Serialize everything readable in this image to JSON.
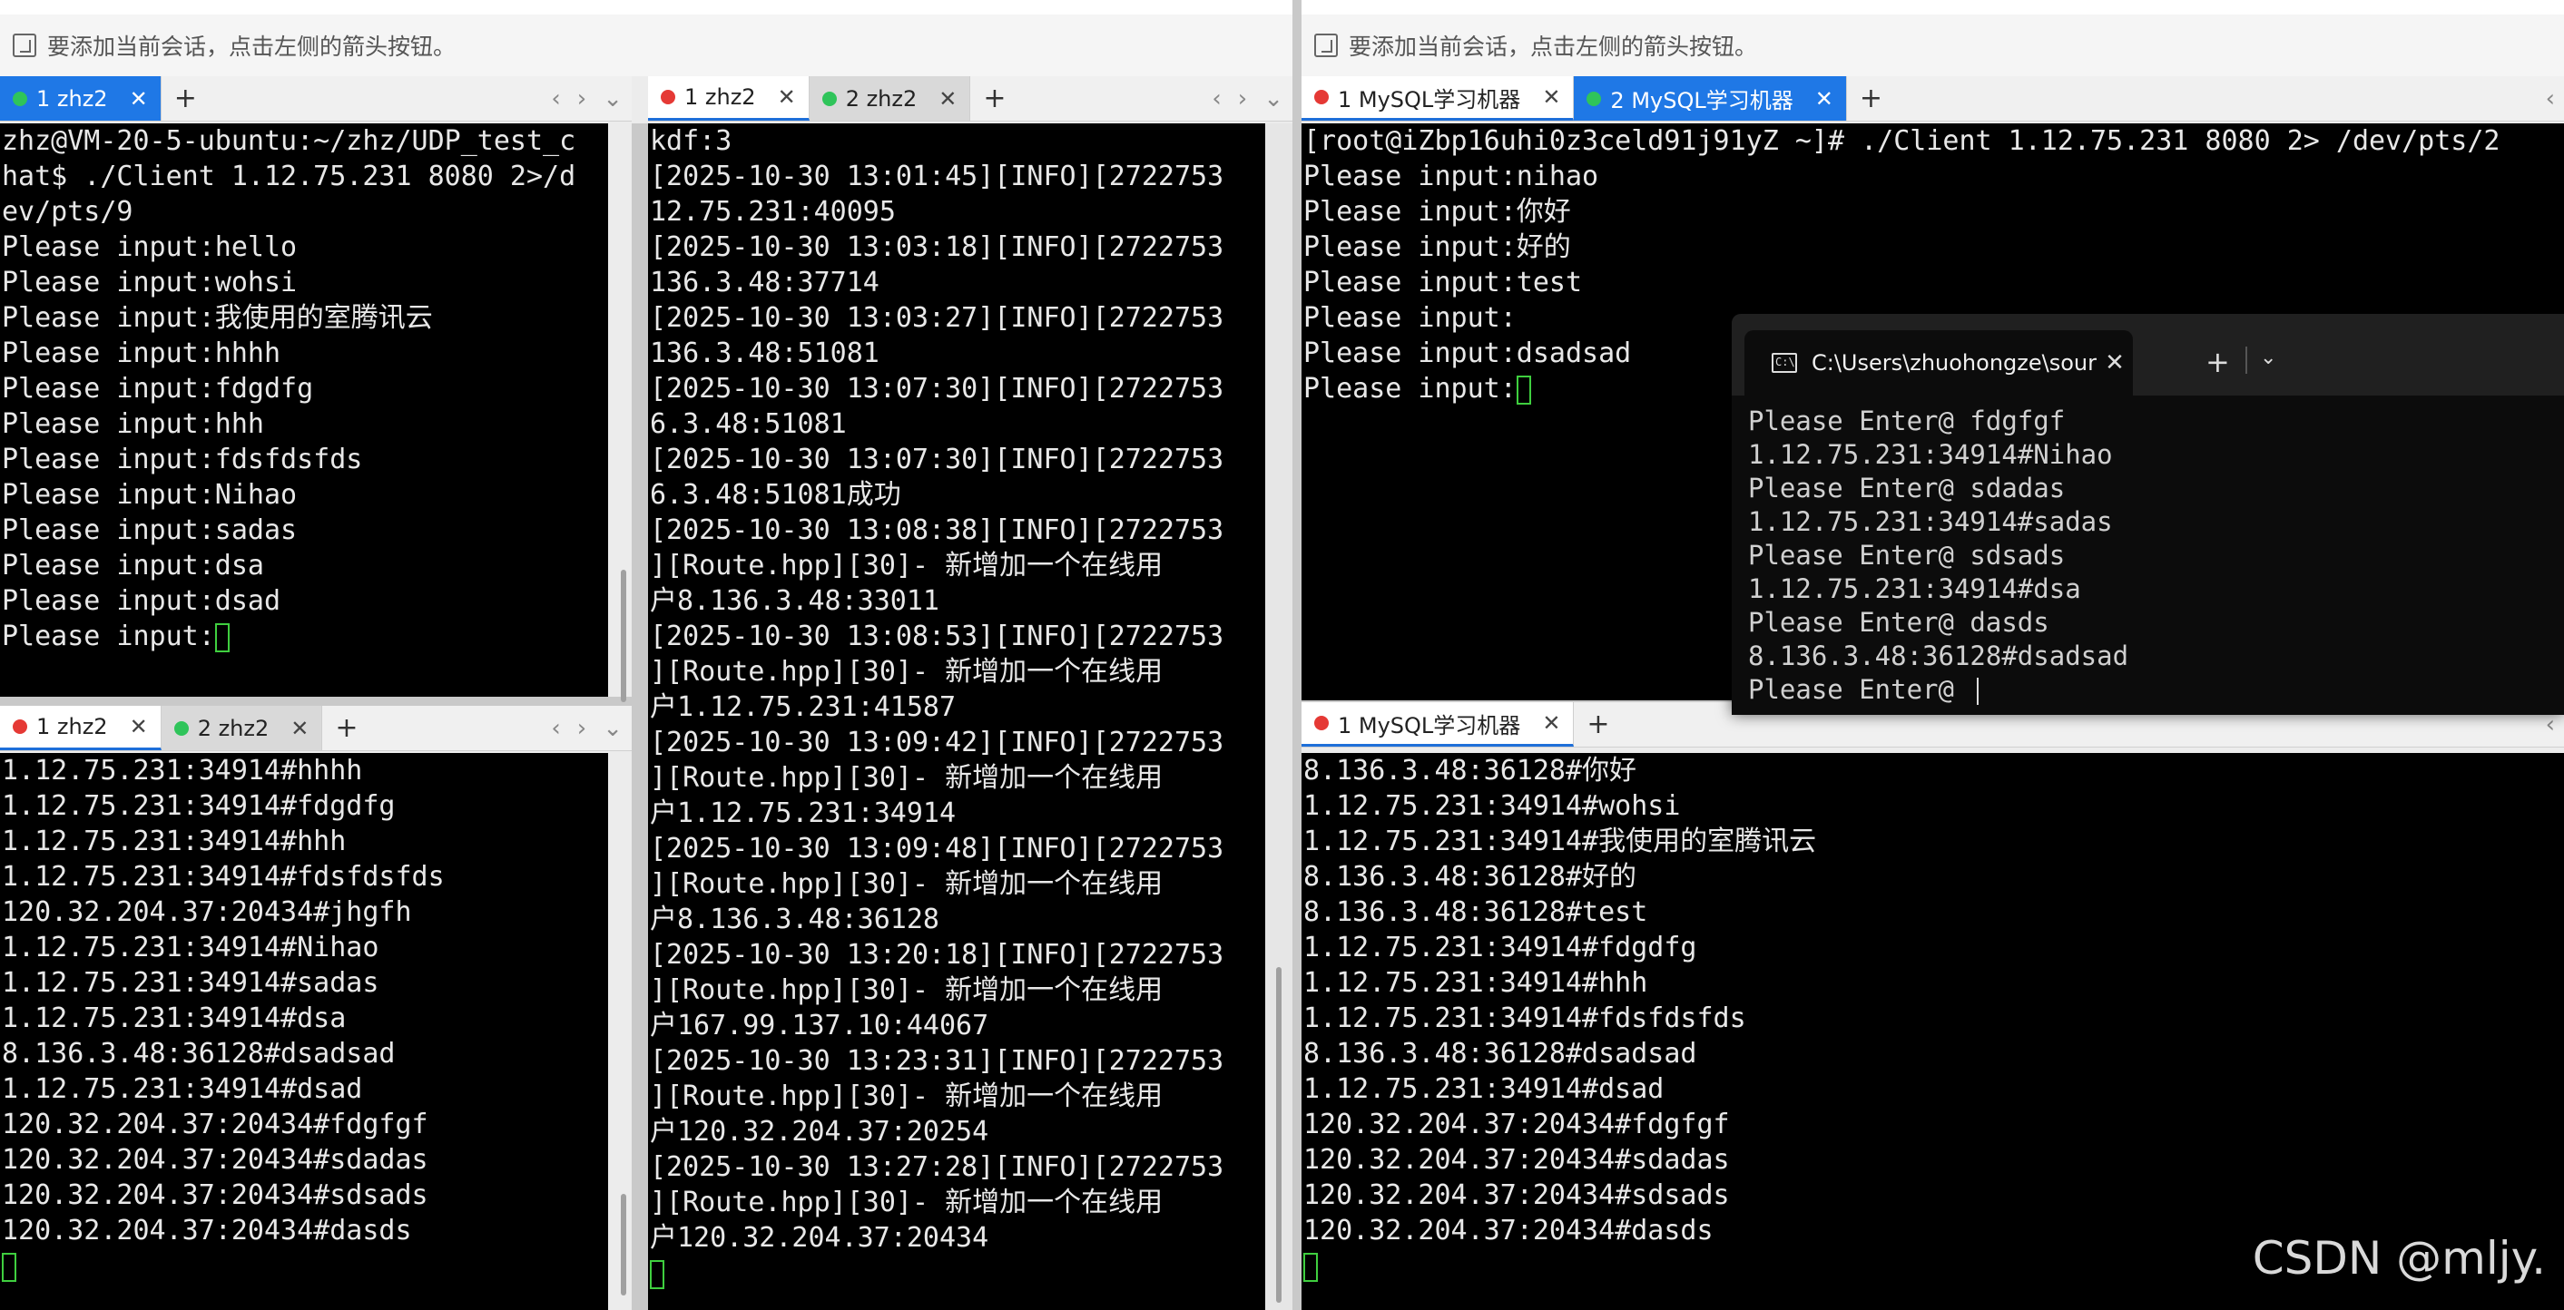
{
  "notice_text": "要添加当前会话，点击左侧的箭头按钮。",
  "left_top": {
    "tabs": [
      {
        "label": "1 zhz2",
        "status": "green"
      }
    ],
    "lines": [
      "zhz@VM-20-5-ubuntu:~/zhz/UDP_test_c",
      "hat$ ./Client 1.12.75.231 8080 2>/d",
      "ev/pts/9",
      "Please input:hello",
      "Please input:wohsi",
      "Please input:我使用的室腾讯云",
      "Please input:hhhh",
      "Please input:fdgdfg",
      "Please input:hhh",
      "Please input:fdsfdsfds",
      "Please input:Nihao",
      "Please input:sadas",
      "Please input:dsa",
      "Please input:dsad",
      "Please input:"
    ]
  },
  "left_bottom": {
    "tabs": [
      {
        "label": "1 zhz2",
        "status": "red"
      },
      {
        "label": "2 zhz2",
        "status": "green"
      }
    ],
    "lines": [
      "1.12.75.231:34914#hhhh",
      "1.12.75.231:34914#fdgdfg",
      "1.12.75.231:34914#hhh",
      "1.12.75.231:34914#fdsfdsfds",
      "120.32.204.37:20434#jhgfh",
      "1.12.75.231:34914#Nihao",
      "1.12.75.231:34914#sadas",
      "1.12.75.231:34914#dsa",
      "8.136.3.48:36128#dsadsad",
      "1.12.75.231:34914#dsad",
      "120.32.204.37:20434#fdgfgf",
      "120.32.204.37:20434#sdadas",
      "120.32.204.37:20434#sdsads",
      "120.32.204.37:20434#dasds",
      ""
    ]
  },
  "middle": {
    "tabs": [
      {
        "label": "1 zhz2",
        "status": "red"
      },
      {
        "label": "2 zhz2",
        "status": "green"
      }
    ],
    "lines": [
      "kdf:3",
      "[2025-10-30 13:01:45][INFO][2722753",
      "12.75.231:40095",
      "[2025-10-30 13:03:18][INFO][2722753",
      "136.3.48:37714",
      "[2025-10-30 13:03:27][INFO][2722753",
      "136.3.48:51081",
      "[2025-10-30 13:07:30][INFO][2722753",
      "6.3.48:51081",
      "[2025-10-30 13:07:30][INFO][2722753",
      "6.3.48:51081成功",
      "[2025-10-30 13:08:38][INFO][2722753",
      "][Route.hpp][30]- 新增加一个在线用",
      "户8.136.3.48:33011",
      "[2025-10-30 13:08:53][INFO][2722753",
      "][Route.hpp][30]- 新增加一个在线用",
      "户1.12.75.231:41587",
      "[2025-10-30 13:09:42][INFO][2722753",
      "][Route.hpp][30]- 新增加一个在线用",
      "户1.12.75.231:34914",
      "[2025-10-30 13:09:48][INFO][2722753",
      "][Route.hpp][30]- 新增加一个在线用",
      "户8.136.3.48:36128",
      "[2025-10-30 13:20:18][INFO][2722753",
      "][Route.hpp][30]- 新增加一个在线用",
      "户167.99.137.10:44067",
      "[2025-10-30 13:23:31][INFO][2722753",
      "][Route.hpp][30]- 新增加一个在线用",
      "户120.32.204.37:20254",
      "[2025-10-30 13:27:28][INFO][2722753",
      "][Route.hpp][30]- 新增加一个在线用",
      "户120.32.204.37:20434",
      ""
    ]
  },
  "right_top": {
    "tabs": [
      {
        "label": "1 MySQL学习机器",
        "status": "red"
      },
      {
        "label": "2 MySQL学习机器",
        "status": "green"
      }
    ],
    "lines": [
      "[root@iZbp16uhi0z3celd91j91yZ ~]# ./Client 1.12.75.231 8080 2> /dev/pts/2",
      "Please input:nihao",
      "Please input:你好",
      "Please input:好的",
      "Please input:test",
      "Please input:",
      "Please input:dsadsad",
      "Please input:"
    ]
  },
  "right_bottom": {
    "tabs": [
      {
        "label": "1 MySQL学习机器",
        "status": "red"
      }
    ],
    "lines": [
      "8.136.3.48:36128#你好",
      "1.12.75.231:34914#wohsi",
      "1.12.75.231:34914#我使用的室腾讯云",
      "8.136.3.48:36128#好的",
      "8.136.3.48:36128#test",
      "1.12.75.231:34914#fdgdfg",
      "1.12.75.231:34914#hhh",
      "1.12.75.231:34914#fdsfdsfds",
      "8.136.3.48:36128#dsadsad",
      "1.12.75.231:34914#dsad",
      "120.32.204.37:20434#fdgfgf",
      "120.32.204.37:20434#sdadas",
      "120.32.204.37:20434#sdsads",
      "120.32.204.37:20434#dasds",
      ""
    ]
  },
  "overlay": {
    "tab_title": "C:\\Users\\zhuohongze\\source\\r",
    "lines": [
      "Please Enter@ fdgfgf",
      "1.12.75.231:34914#Nihao",
      "Please Enter@ sdadas",
      "1.12.75.231:34914#sadas",
      "Please Enter@ sdsads",
      "1.12.75.231:34914#dsa",
      "Please Enter@ dasds",
      "8.136.3.48:36128#dsadsad",
      "Please Enter@ "
    ]
  },
  "watermark": "CSDN @mljy.",
  "colors": {
    "accent": "#1f78e6",
    "status_red": "#e53935",
    "status_green": "#2fc45a",
    "cursor": "#3fcf3f"
  }
}
